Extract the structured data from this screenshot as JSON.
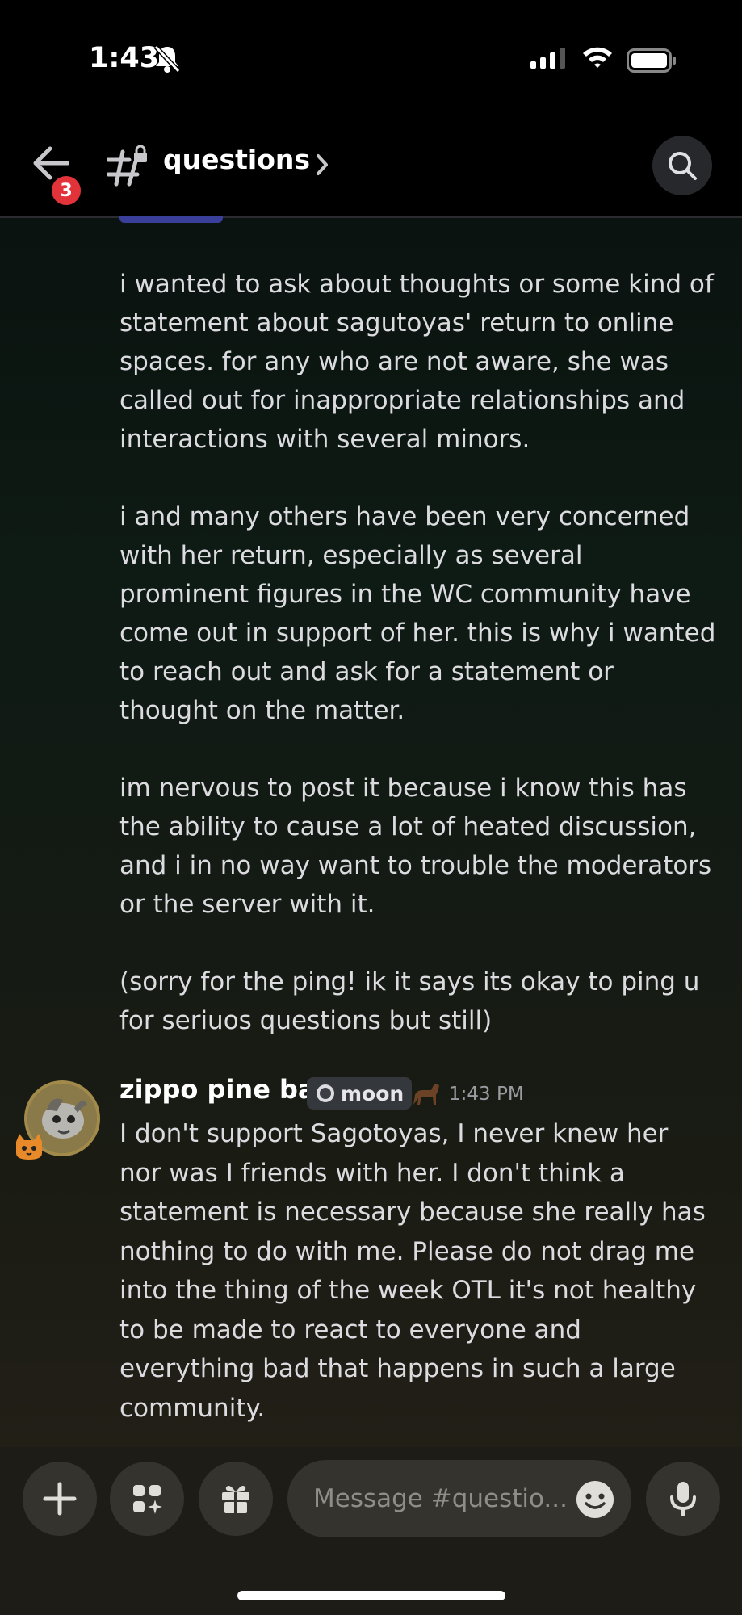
{
  "status": {
    "time": "1:43"
  },
  "header": {
    "channel": "questions",
    "unread_count": "3"
  },
  "message": {
    "paragraphs": [
      "i wanted to ask about thoughts or some kind of statement about sagutoyas' return to online spaces. for any who are not aware, she was called out for inappropriate relationships and interactions with several minors.",
      "i and many others have been very concerned with her return, especially as several prominent figures in the WC community have come out in support of her. this is why i wanted to reach out and ask for a statement or thought on the matter.",
      "im nervous to post it because i know this has the ability to cause a lot of heated discussion, and i in no way want to trouble the moderators or the server with it.",
      "(sorry for the ping! ik it says its okay to ping u for seriuos questions but still)"
    ]
  },
  "reply": {
    "username": "zippo pine bar",
    "tag": "moon",
    "timestamp": "1:43 PM",
    "text": "I don't support Sagotoyas, I never knew her nor was I friends with her. I don't think a statement is necessary because she really has nothing to do with me. Please do not drag me into the thing of the week OTL it's not healthy to be made to react to everyone and everything bad that happens in such a large community."
  },
  "composer": {
    "placeholder": "Message #questio..."
  },
  "icons": [
    "bell-slash-icon",
    "signal-icon",
    "wifi-icon",
    "battery-icon",
    "back-arrow-icon",
    "locked-channel-icon",
    "chevron-right-icon",
    "search-icon",
    "plus-icon",
    "apps-icon",
    "gift-icon",
    "emoji-icon",
    "microphone-icon"
  ]
}
